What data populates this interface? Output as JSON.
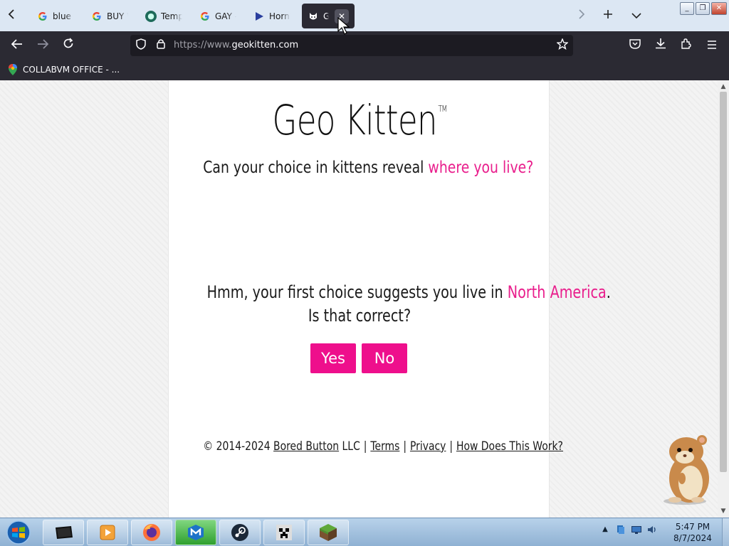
{
  "browser": {
    "tabs": [
      {
        "title": "blue",
        "icon": "google-g-icon",
        "active": false
      },
      {
        "title": "BUY W",
        "icon": "google-g-icon",
        "active": false
      },
      {
        "title": "Temp",
        "icon": "temp-site-icon",
        "active": false
      },
      {
        "title": "GAY -",
        "icon": "google-g-icon",
        "active": false
      },
      {
        "title": "Horni",
        "icon": "play-triangle-icon",
        "active": false
      },
      {
        "title": "Ge",
        "icon": "geokitten-cat-icon",
        "active": true
      }
    ],
    "url_prefix": "https://www.",
    "url_domain": "geokitten.com",
    "bookmark_label": "COLLABVM OFFICE - ..."
  },
  "page": {
    "title": "Geo Kitten",
    "trademark": "TM",
    "subtitle_plain": "Can your choice in kittens reveal ",
    "subtitle_highlight": "where you live?",
    "question_plain": "Hmm, your first choice suggests you live in ",
    "question_highlight": "North America",
    "question_end": ".",
    "question_line2": "Is that correct?",
    "yes_label": "Yes",
    "no_label": "No",
    "footer": {
      "copyright": "© 2014-2024 ",
      "company_link": "Bored Button",
      "company_suffix": " LLC",
      "sep": "|",
      "terms": "Terms",
      "privacy": "Privacy",
      "how": "How Does This Work?"
    }
  },
  "taskbar": {
    "apps": [
      "windows-explorer-icon",
      "media-player-icon",
      "firefox-icon",
      "malwarebytes-icon",
      "steam-icon",
      "creeper-icon",
      "minecraft-grass-icon"
    ],
    "time": "5:47 PM",
    "date": "8/7/2024"
  },
  "colors": {
    "accent_pink": "#ee0f8c",
    "tab_strip": "#dce7f3",
    "toolbar_dark": "#2b2a33"
  }
}
